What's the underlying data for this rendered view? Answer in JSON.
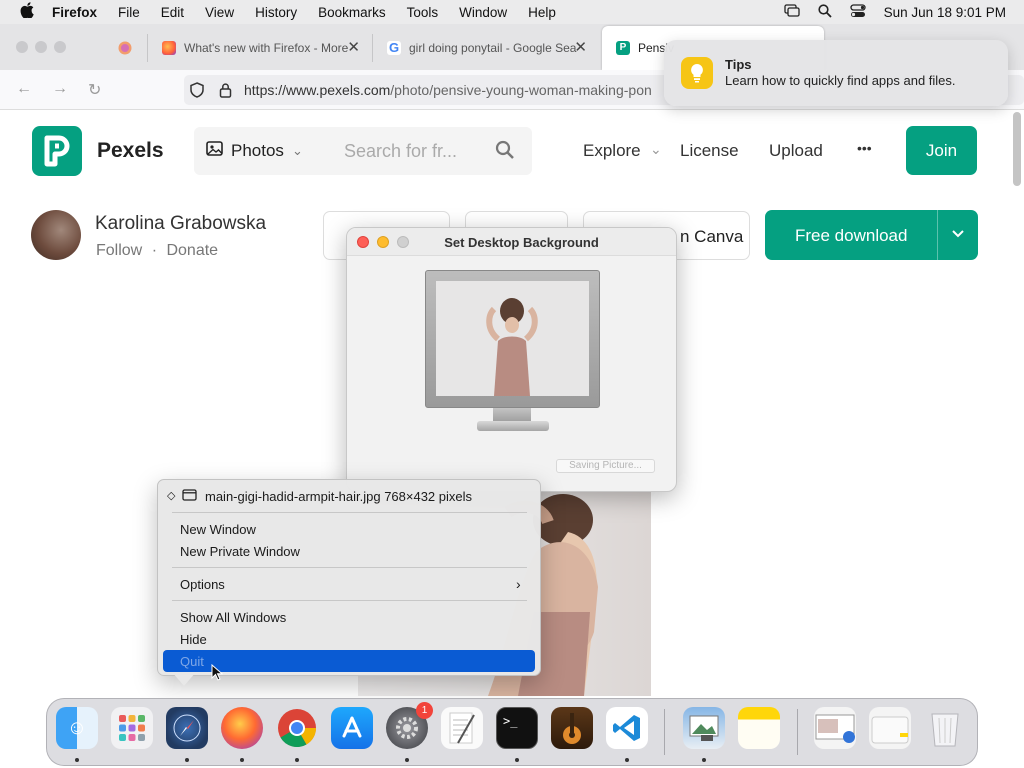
{
  "menubar": {
    "app": "Firefox",
    "items": [
      "File",
      "Edit",
      "View",
      "History",
      "Bookmarks",
      "Tools",
      "Window",
      "Help"
    ],
    "clock": "Sun Jun 18  9:01 PM"
  },
  "tabs": [
    {
      "title": "What's new with Firefox - More"
    },
    {
      "title": "girl doing ponytail - Google Sea"
    },
    {
      "title": "Pensiv"
    }
  ],
  "url": {
    "domain": "https://www.pexels.com",
    "path": "/photo/pensive-young-woman-making-pon"
  },
  "tips": {
    "title": "Tips",
    "body": "Learn how to quickly find apps and files."
  },
  "site": {
    "brand": "Pexels",
    "photos_label": "Photos",
    "search_placeholder": "Search for fr...",
    "nav": [
      "Explore",
      "License",
      "Upload"
    ],
    "more": "•••",
    "join": "Join"
  },
  "author": {
    "name": "Karolina Grabowska",
    "follow": "Follow",
    "donate": "Donate"
  },
  "actions": {
    "canva": "n Canva",
    "download": "Free download"
  },
  "dialog": {
    "title": "Set Desktop Background",
    "status": "Saving Picture..."
  },
  "context_menu": {
    "header": "main-gigi-hadid-armpit-hair.jpg 768×432 pixels",
    "new_window": "New Window",
    "new_private_window": "New Private Window",
    "options": "Options",
    "show_all_windows": "Show All Windows",
    "hide": "Hide",
    "quit": "Quit"
  },
  "dock": {
    "settings_badge": "1"
  },
  "colors": {
    "brand_green": "#05a081",
    "menu_highlight": "#0a5bd3"
  }
}
